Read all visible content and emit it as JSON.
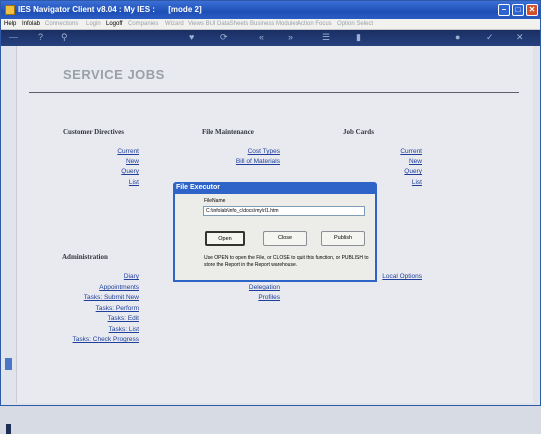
{
  "window": {
    "title": "IES Navigator Client v8.04 : My IES :      [mode 2]"
  },
  "menu": {
    "items": [
      {
        "label": "Help",
        "enabled": true
      },
      {
        "label": "Infolab",
        "enabled": true
      },
      {
        "label": "Connections",
        "enabled": false
      },
      {
        "label": "Login",
        "enabled": false
      },
      {
        "label": "Logoff",
        "enabled": true
      },
      {
        "label": "Companies",
        "enabled": false
      },
      {
        "label": "Wizard",
        "enabled": false
      },
      {
        "label": "Views BUI",
        "enabled": false
      },
      {
        "label": "DataSheets",
        "enabled": false
      },
      {
        "label": "Business Modules",
        "enabled": false
      },
      {
        "label": "Action Focus",
        "enabled": false
      },
      {
        "label": "Option Select",
        "enabled": false
      }
    ]
  },
  "page": {
    "title": "SERVICE JOBS"
  },
  "sections": {
    "customer_directives": {
      "heading": "Customer Directives",
      "links": [
        "Current",
        "New",
        "Query",
        "List"
      ]
    },
    "file_maintenance": {
      "heading": "File Maintenance",
      "links": [
        "Cost Types",
        "Bill of Materials"
      ]
    },
    "job_cards": {
      "heading": "Job Cards",
      "links": [
        "Current",
        "New",
        "Query",
        "List"
      ]
    },
    "administration": {
      "heading": "Administration",
      "links": [
        "Diary",
        "Appointments",
        "Tasks: Submit New",
        "Tasks: Perform",
        "Tasks: Edit",
        "Tasks: List",
        "Tasks: Check Progress"
      ]
    },
    "middle_links": [
      "Delegation",
      "Profiles"
    ],
    "right_links": [
      "Local Options"
    ]
  },
  "dialog": {
    "title": "File Executor",
    "field_label": "FileName",
    "field_value": "C:\\infolab\\info_c\\docs\\my\\rl1.htm",
    "open_label": "Open",
    "close_label": "Close",
    "publish_label": "Publish",
    "message": "Use OPEN to open the File, or CLOSE to quit this function, or PUBLISH to store the Report in the Report warehouse."
  }
}
